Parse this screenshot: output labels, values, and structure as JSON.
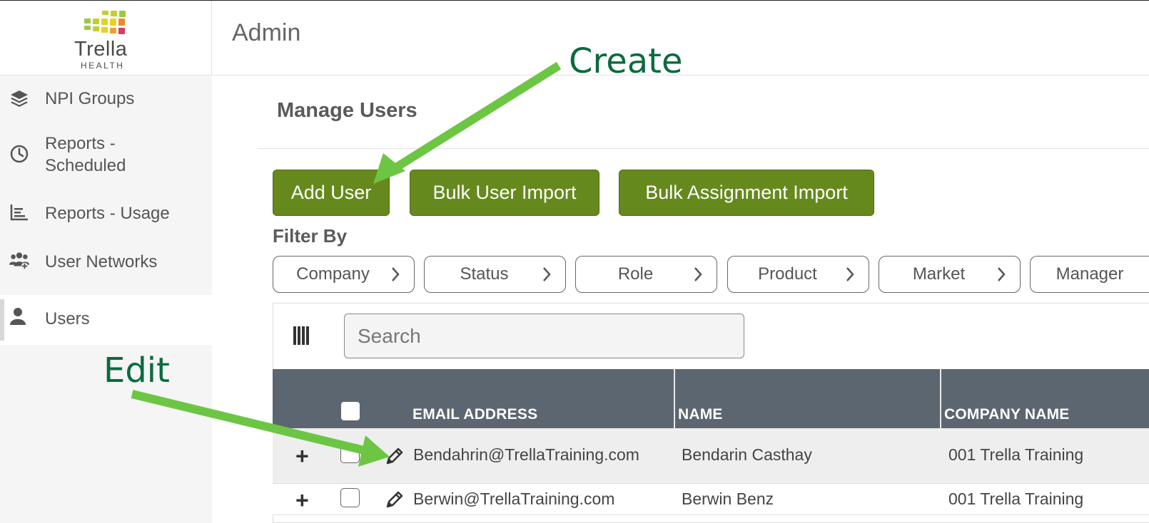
{
  "app": {
    "brand": "Trella",
    "brand_sub": "HEALTH",
    "header_title": "Admin",
    "colors": {
      "accent": "#66891e",
      "table_header": "#5c6670",
      "annotation": "#0a6b3e",
      "arrow": "#6cc644"
    }
  },
  "sidebar": {
    "items": [
      {
        "label": "NPI Groups",
        "icon": "layers-icon"
      },
      {
        "label": "Reports -\nScheduled",
        "icon": "clock-icon"
      },
      {
        "label": "Reports - Usage",
        "icon": "bar-chart-icon"
      },
      {
        "label": "User Networks",
        "icon": "users-group-icon"
      },
      {
        "label": "Users",
        "icon": "user-icon",
        "active": true
      }
    ]
  },
  "main": {
    "title": "Manage Users",
    "buttons": {
      "add_user": "Add User",
      "bulk_user_import": "Bulk User Import",
      "bulk_assignment_import": "Bulk Assignment Import"
    },
    "filter_label": "Filter By",
    "filters": [
      "Company",
      "Status",
      "Role",
      "Product",
      "Market",
      "Manager"
    ],
    "search": {
      "placeholder": "Search",
      "value": ""
    },
    "table": {
      "columns": [
        "EMAIL ADDRESS",
        "NAME",
        "COMPANY NAME"
      ],
      "rows": [
        {
          "email": "Bendahrin@TrellaTraining.com",
          "name": "Bendarin Casthay",
          "company": "001 Trella Training"
        },
        {
          "email": "Berwin@TrellaTraining.com",
          "name": "Berwin Benz",
          "company": "001 Trella Training"
        }
      ]
    }
  },
  "annotations": {
    "create": "Create",
    "edit": "Edit"
  }
}
